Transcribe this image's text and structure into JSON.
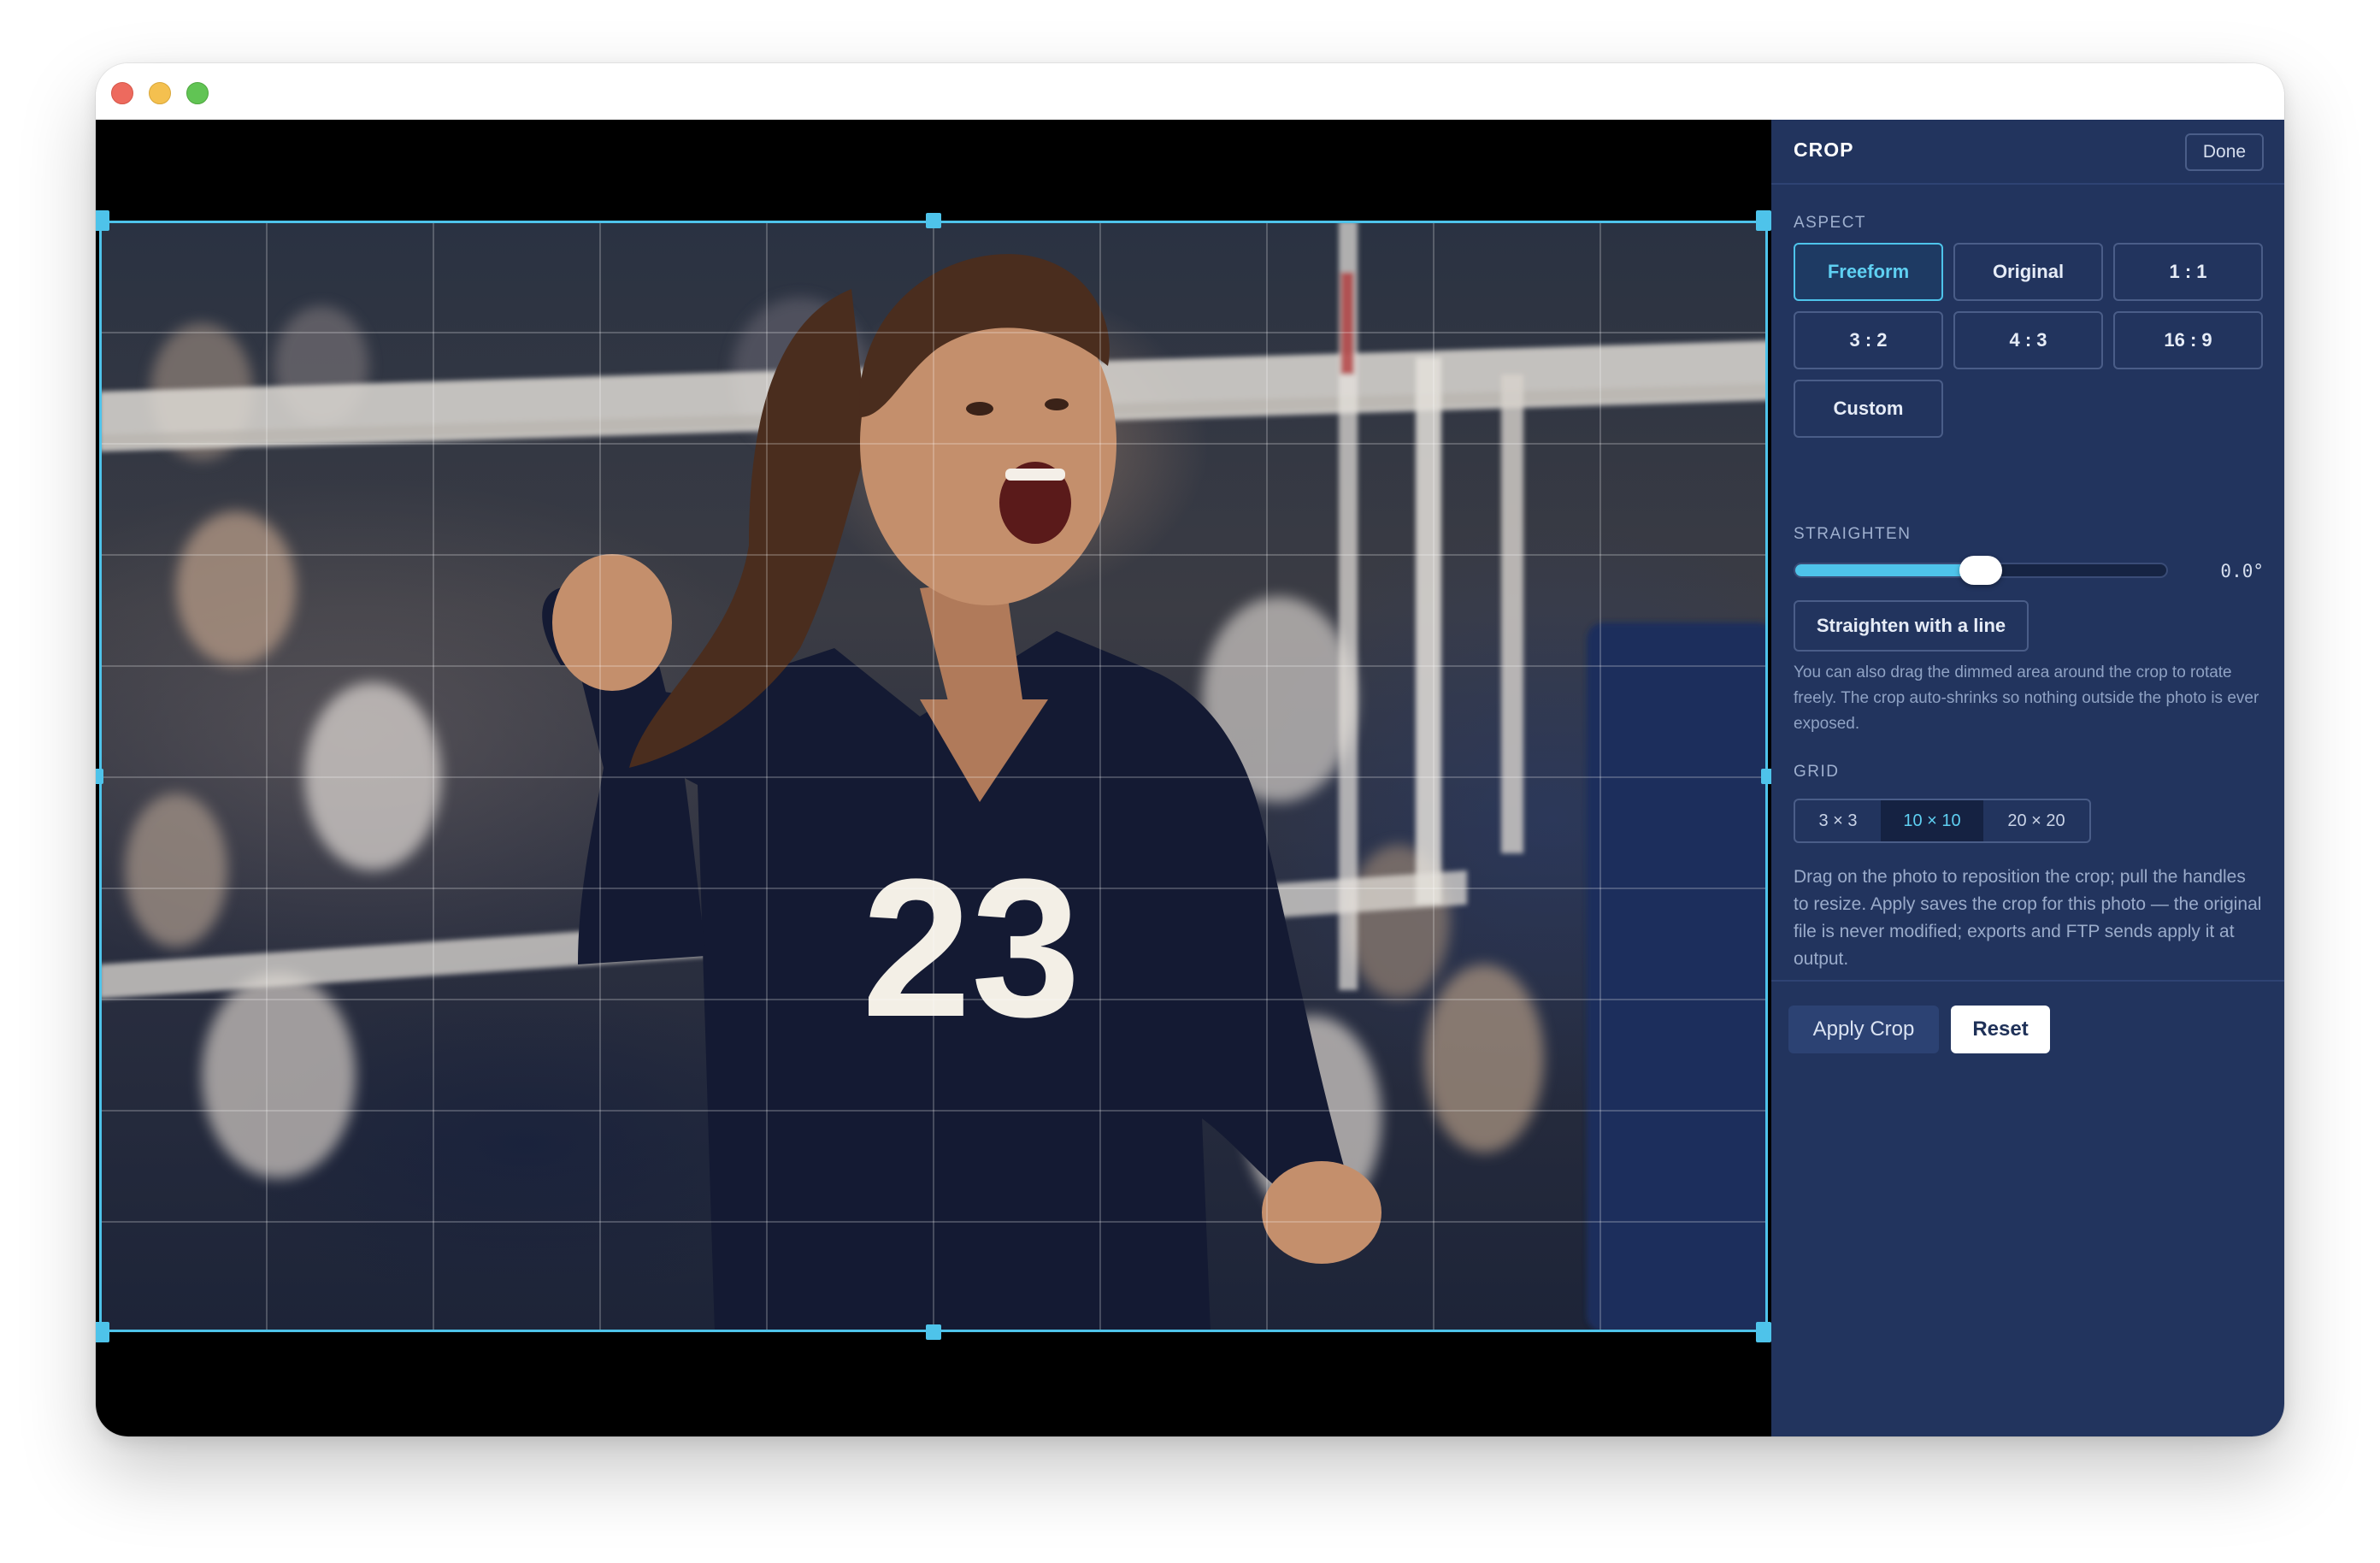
{
  "window": {
    "controls": [
      "close",
      "minimize",
      "zoom"
    ]
  },
  "photo": {
    "jersey_number": "23"
  },
  "panel": {
    "title": "CROP",
    "done_label": "Done",
    "aspect": {
      "label": "ASPECT",
      "options": [
        "Freeform",
        "Original",
        "1 : 1",
        "3 : 2",
        "4 : 3",
        "16 : 9",
        "Custom"
      ],
      "selected": "Freeform"
    },
    "straighten": {
      "label": "STRAIGHTEN",
      "value_text": "0.0°",
      "slider_fraction": 0.5,
      "line_button": "Straighten with a line",
      "help": "You can also drag the dimmed area around the crop to rotate freely. The crop auto-shrinks so nothing outside the photo is ever exposed."
    },
    "grid": {
      "label": "GRID",
      "options": [
        "3 × 3",
        "10 × 10",
        "20 × 20"
      ],
      "selected": "10 × 10"
    },
    "instructions": "Drag on the photo to reposition the crop; pull the handles to resize. Apply saves the crop for this photo — the original file is never modified; exports and FTP sends apply it at output.",
    "apply_label": "Apply Crop",
    "reset_label": "Reset"
  },
  "colors": {
    "panel_bg": "#22345e",
    "accent": "#4ec3ea",
    "stage_bg": "#000000"
  }
}
